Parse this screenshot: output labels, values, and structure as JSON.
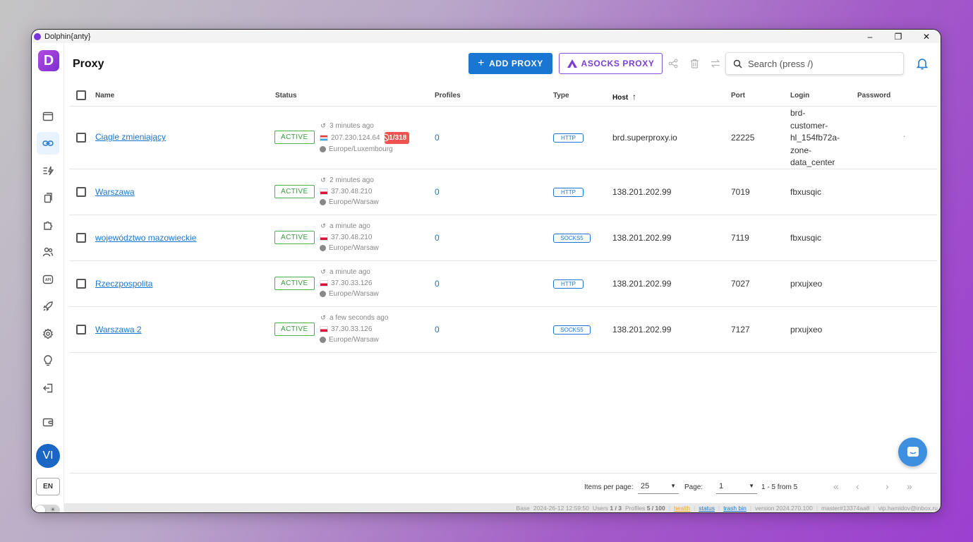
{
  "app": {
    "title": "Dolphin{anty}"
  },
  "window_controls": {
    "minimize": "–",
    "restore": "❐",
    "close": "✕"
  },
  "header": {
    "title": "Proxy",
    "add_label": "ADD PROXY",
    "asocks_label": "ASOCKS PROXY",
    "search_placeholder": "Search (press /)"
  },
  "logo_letter": "D",
  "columns": {
    "name": "Name",
    "status": "Status",
    "profiles": "Profiles",
    "type": "Type",
    "host": "Host",
    "host_sort_icon": "↑",
    "port": "Port",
    "login": "Login",
    "password": "Password"
  },
  "rows": [
    {
      "name": "Ciągle zmieniający",
      "status": "ACTIVE",
      "checked_ago": "3 minutes ago",
      "ip": "207.230.124.64",
      "flag": "lu",
      "blocked": "1/318",
      "timezone": "Europe/Luxembourg",
      "profiles": "0",
      "type": "HTTP",
      "host": "brd.superproxy.io",
      "port": "22225",
      "login": "brd-customer-hl_154fb72a-zone-data_center",
      "password": "."
    },
    {
      "name": "Warszawa",
      "status": "ACTIVE",
      "checked_ago": "2 minutes ago",
      "ip": "37.30.48.210",
      "flag": "pl",
      "timezone": "Europe/Warsaw",
      "profiles": "0",
      "type": "HTTP",
      "host": "138.201.202.99",
      "port": "7019",
      "login": "fbxusqic"
    },
    {
      "name": "województwo mazowieckie",
      "status": "ACTIVE",
      "checked_ago": "a minute ago",
      "ip": "37.30.48.210",
      "flag": "pl",
      "timezone": "Europe/Warsaw",
      "profiles": "0",
      "type": "SOCKS5",
      "host": "138.201.202.99",
      "port": "7119",
      "login": "fbxusqic"
    },
    {
      "name": "Rzeczpospolita",
      "status": "ACTIVE",
      "checked_ago": "a minute ago",
      "ip": "37.30.33.126",
      "flag": "pl",
      "timezone": "Europe/Warsaw",
      "profiles": "0",
      "type": "HTTP",
      "host": "138.201.202.99",
      "port": "7027",
      "login": "prxujxeo"
    },
    {
      "name": "Warszawa 2",
      "status": "ACTIVE",
      "checked_ago": "a few seconds ago",
      "ip": "37.30.33.126",
      "flag": "pl",
      "timezone": "Europe/Warsaw",
      "profiles": "0",
      "type": "SOCKS5",
      "host": "138.201.202.99",
      "port": "7127",
      "login": "prxujxeo"
    }
  ],
  "login_lines": [
    "brd-",
    "customer-",
    "hl_154fb72a-",
    "zone-",
    "data_center"
  ],
  "pagination": {
    "items_per_page_label": "Items per page:",
    "items_per_page": "25",
    "page_label": "Page:",
    "page": "1",
    "range": "1 - 5 from 5"
  },
  "sidebar": {
    "avatar": "VI",
    "lang": "EN",
    "theme_icon": "☀"
  },
  "statusbar": {
    "base": "Base",
    "date": "2024-26-12 12:59:50",
    "users_label": "Users",
    "users": "1 / 3",
    "profiles_label": "Profiles",
    "profiles": "5 / 100",
    "health": "health",
    "status": "status",
    "trash": "trash bin",
    "version": "version 2024.270.100",
    "master": "master#13374aa8",
    "email": "vip.hamidov@inbox.ru"
  },
  "colors": {
    "accent": "#1976d2",
    "brand": "#7b2fd1",
    "active": "#4caf50",
    "blocked": "#ef5350"
  }
}
